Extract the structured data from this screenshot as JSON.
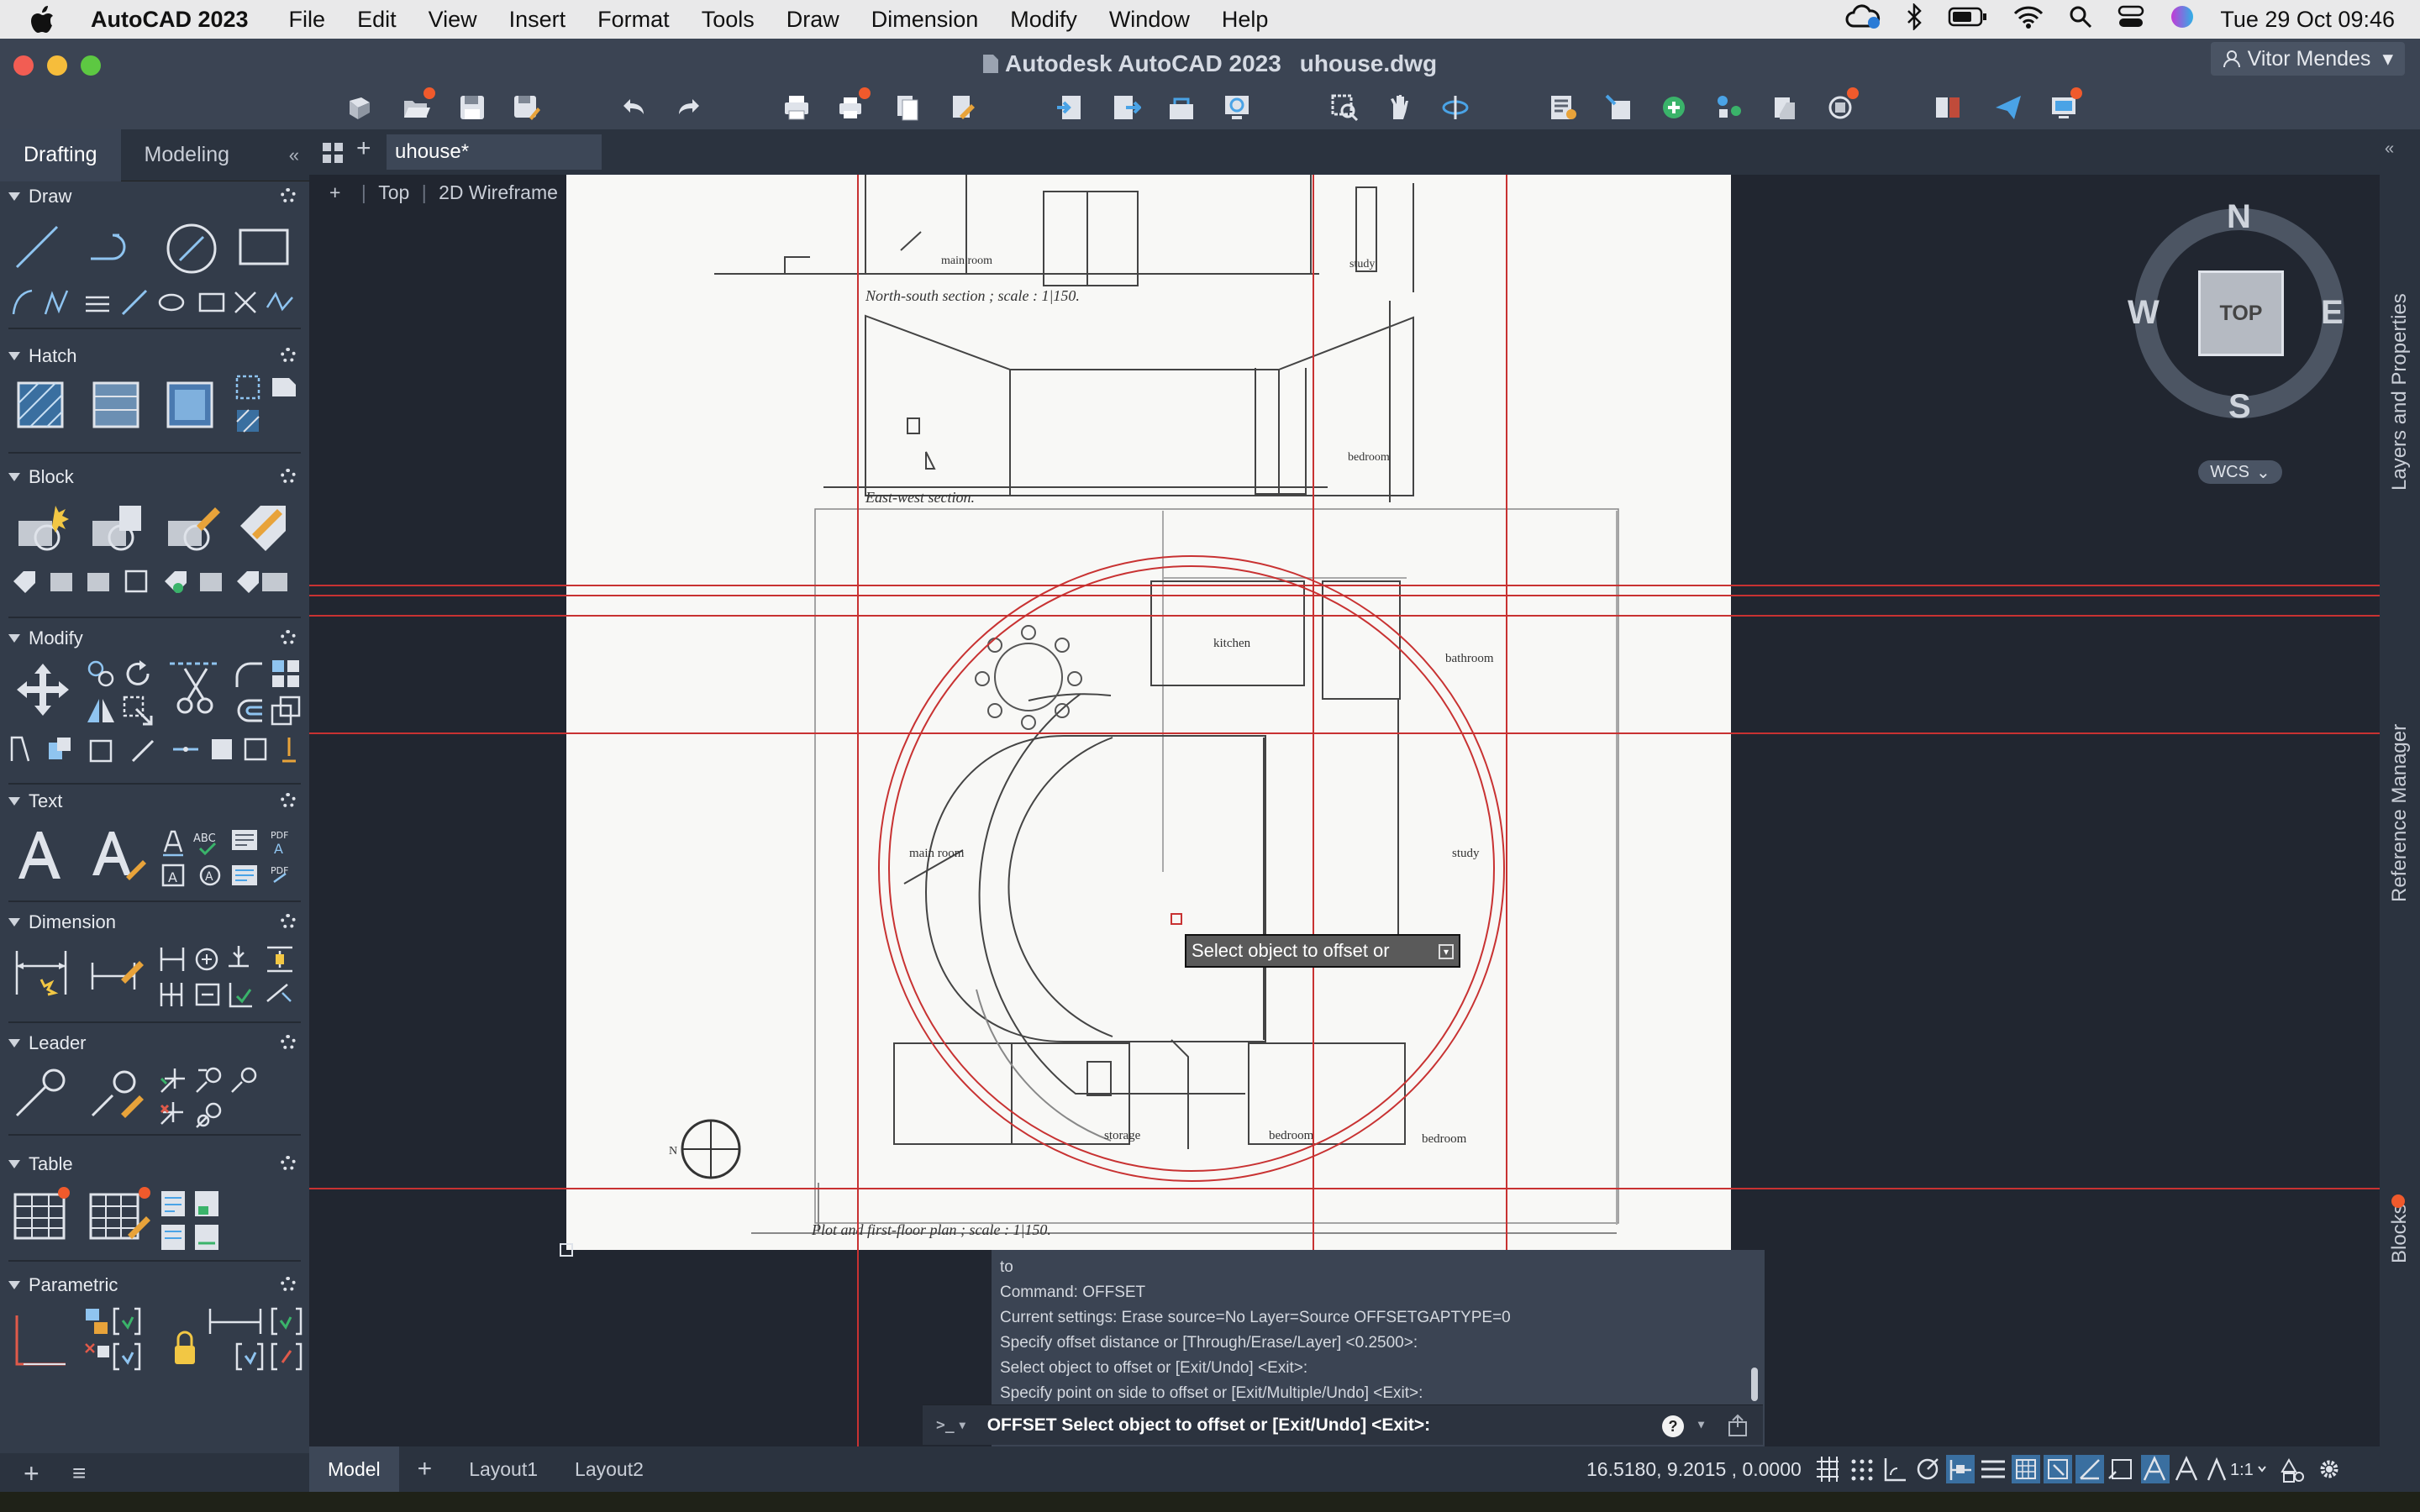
{
  "menubar": {
    "app_name": "AutoCAD 2023",
    "items": [
      "File",
      "Edit",
      "View",
      "Insert",
      "Format",
      "Tools",
      "Draw",
      "Dimension",
      "Modify",
      "Window",
      "Help"
    ],
    "datetime": "Tue 29 Oct  09:46"
  },
  "window": {
    "title": "Autodesk AutoCAD 2023",
    "filename": "uhouse.dwg",
    "user": "Vitor Mendes"
  },
  "workspace_tabs": [
    "Drafting",
    "Modeling"
  ],
  "panels": {
    "draw": "Draw",
    "hatch": "Hatch",
    "block": "Block",
    "modify": "Modify",
    "text": "Text",
    "dimension": "Dimension",
    "leader": "Leader",
    "table": "Table",
    "parametric": "Parametric"
  },
  "doc_tab": "uhouse*",
  "viewport": {
    "plus": "+",
    "view": "Top",
    "style": "2D Wireframe"
  },
  "viewcube": {
    "n": "N",
    "s": "S",
    "e": "E",
    "w": "W",
    "top": "TOP",
    "wcs": "WCS"
  },
  "drawing_labels": {
    "ns_section": "North-south section ; scale :   1|150.",
    "ew_section": "East-west section.",
    "plan": "Plot and first-floor plan ; scale :   1|150.",
    "main_room_top": "main room",
    "study_top": "study",
    "bedroom_top": "bedroom",
    "kitchen": "kitchen",
    "bathroom": "bathroom",
    "main_room": "main room",
    "study": "study",
    "storage": "storage",
    "bedroom1": "bedroom",
    "bedroom2": "bedroom",
    "north": "N"
  },
  "dynamic_prompt": "Select object to offset or",
  "command": {
    "history": [
      "to",
      "Command: OFFSET",
      "Current settings: Erase source=No  Layer=Source  OFFSETGAPTYPE=0",
      "Specify offset distance or [Through/Erase/Layer] <0.2500>:",
      "Select object to offset or [Exit/Undo] <Exit>:",
      "Specify point on side to offset or [Exit/Multiple/Undo] <Exit>:"
    ],
    "prompt_icon": ">_",
    "current": "OFFSET Select object to offset or [Exit/Undo] <Exit>:"
  },
  "status": {
    "tabs": [
      "Model",
      "Layout1",
      "Layout2"
    ],
    "coords": "16.5180, 9.2015 , 0.0000",
    "scale": "1:1"
  },
  "right_palettes": [
    "Layers and Properties",
    "Reference Manager",
    "Blocks"
  ]
}
